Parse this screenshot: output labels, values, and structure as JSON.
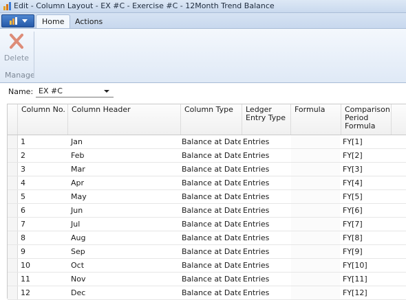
{
  "window": {
    "title": "Edit - Column Layout - EX #C - Exercise #C - 12Month Trend Balance"
  },
  "ribbon": {
    "tabs": [
      {
        "label": "Home"
      },
      {
        "label": "Actions"
      }
    ],
    "delete_label": "Delete",
    "group_label": "Manage"
  },
  "filter": {
    "name_label": "Name:",
    "name_value": "EX #C"
  },
  "grid": {
    "headers": {
      "column_no": "Column No.",
      "column_header": "Column Header",
      "column_type": "Column Type",
      "ledger_entry_type": "Ledger Entry Type",
      "formula": "Formula",
      "comparison_period_formula": "Comparison Period Formula"
    },
    "rows": [
      {
        "no": "1",
        "header": "Jan",
        "type": "Balance at Date",
        "ledger": "Entries",
        "formula": "",
        "cpf": "FY[1]"
      },
      {
        "no": "2",
        "header": "Feb",
        "type": "Balance at Date",
        "ledger": "Entries",
        "formula": "",
        "cpf": "FY[2]"
      },
      {
        "no": "3",
        "header": "Mar",
        "type": "Balance at Date",
        "ledger": "Entries",
        "formula": "",
        "cpf": "FY[3]"
      },
      {
        "no": "4",
        "header": "Apr",
        "type": "Balance at Date",
        "ledger": "Entries",
        "formula": "",
        "cpf": "FY[4]"
      },
      {
        "no": "5",
        "header": "May",
        "type": "Balance at Date",
        "ledger": "Entries",
        "formula": "",
        "cpf": "FY[5]"
      },
      {
        "no": "6",
        "header": "Jun",
        "type": "Balance at Date",
        "ledger": "Entries",
        "formula": "",
        "cpf": "FY[6]"
      },
      {
        "no": "7",
        "header": "Jul",
        "type": "Balance at Date",
        "ledger": "Entries",
        "formula": "",
        "cpf": "FY[7]"
      },
      {
        "no": "8",
        "header": "Aug",
        "type": "Balance at Date",
        "ledger": "Entries",
        "formula": "",
        "cpf": "FY[8]"
      },
      {
        "no": "9",
        "header": "Sep",
        "type": "Balance at Date",
        "ledger": "Entries",
        "formula": "",
        "cpf": "FY[9]"
      },
      {
        "no": "10",
        "header": "Oct",
        "type": "Balance at Date",
        "ledger": "Entries",
        "formula": "",
        "cpf": "FY[10]"
      },
      {
        "no": "11",
        "header": "Nov",
        "type": "Balance at Date",
        "ledger": "Entries",
        "formula": "",
        "cpf": "FY[11]"
      },
      {
        "no": "12",
        "header": "Dec",
        "type": "Balance at Date",
        "ledger": "Entries",
        "formula": "",
        "cpf": "FY[12]"
      }
    ]
  },
  "icons": {
    "app": "dynamics-nav-icon",
    "delete": "delete-x-icon",
    "dropdown": "chevron-down-icon"
  },
  "colors": {
    "titlebar": "#c9d9ee",
    "app_menu": "#2559a8",
    "delete_icon": "#d9826f"
  }
}
